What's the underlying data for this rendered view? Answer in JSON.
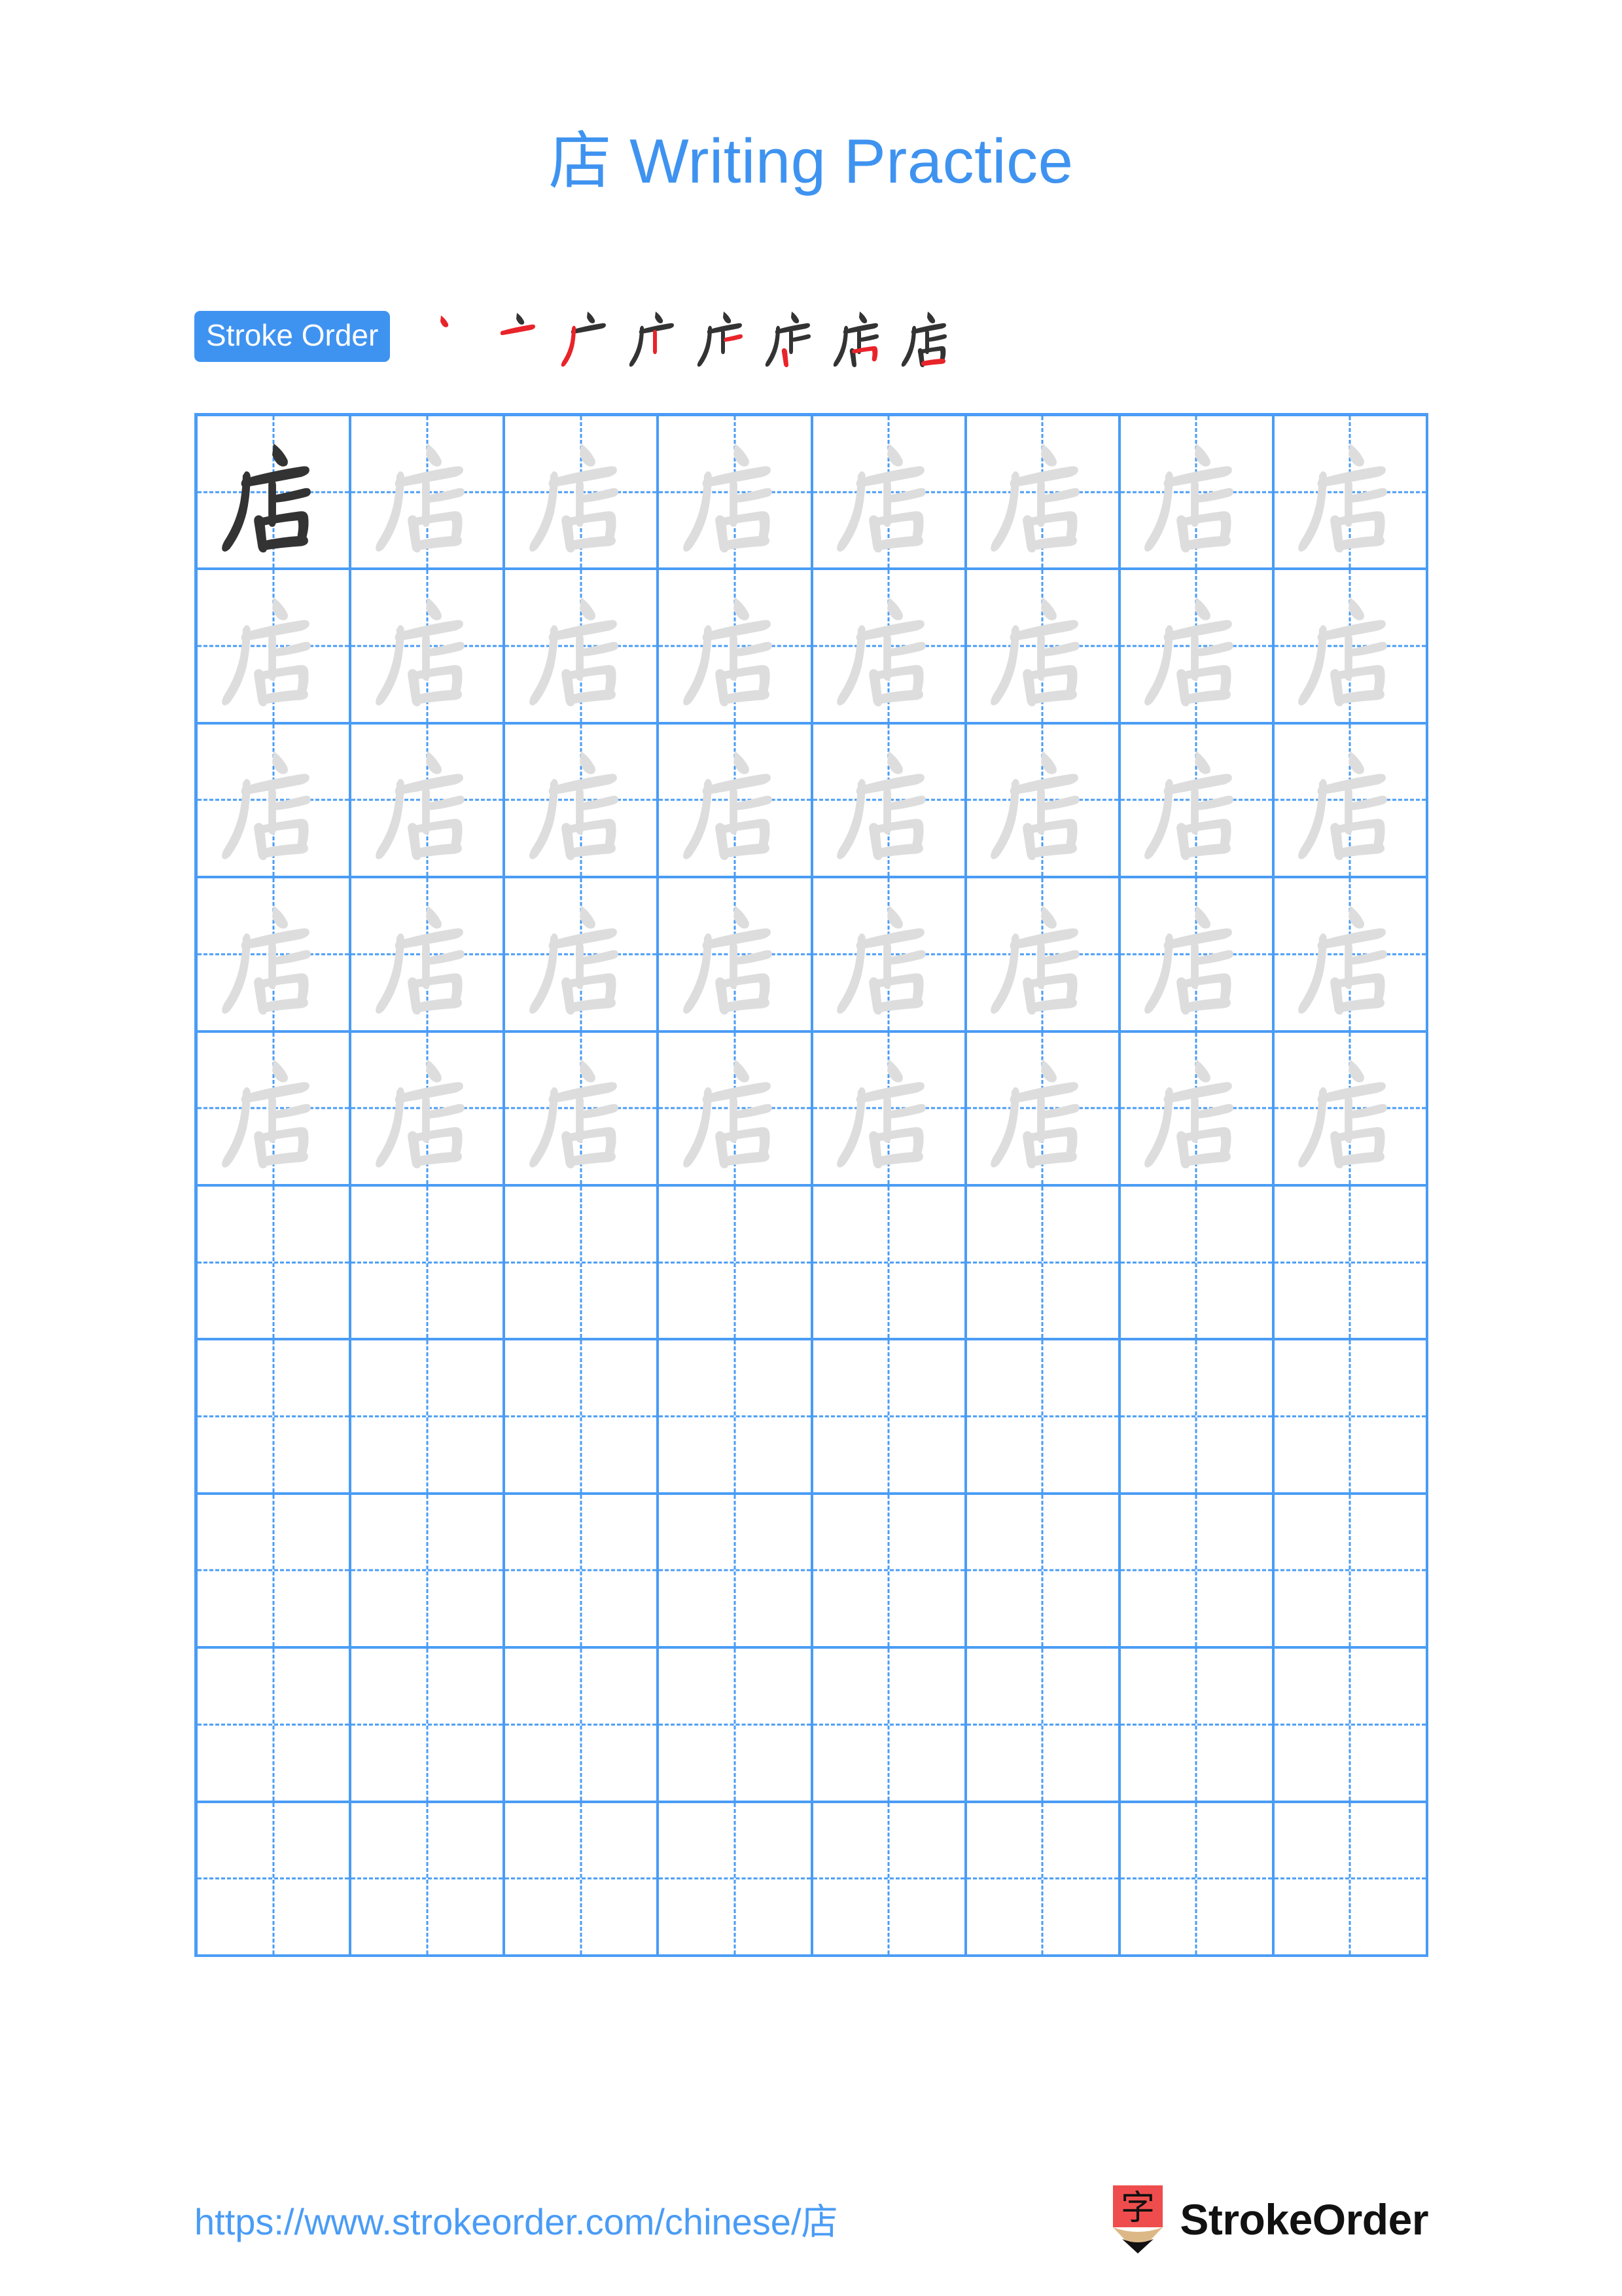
{
  "page": {
    "title": "店 Writing Practice",
    "character": "店",
    "background_color": "#ffffff",
    "accent_color": "#3f93f0",
    "grid_line_color": "#4a9cf5",
    "traced_char_color": "#dddddd",
    "model_char_color": "#333333",
    "new_stroke_color": "#e8242a"
  },
  "stroke_order": {
    "badge_label": "Stroke Order",
    "stroke_count": 8,
    "steps": [
      {
        "index": 1,
        "partial": "丶",
        "new_stroke": "dot"
      },
      {
        "index": 2,
        "partial": "亠",
        "new_stroke": "horizontal"
      },
      {
        "index": 3,
        "partial": "广",
        "new_stroke": "left-falling"
      },
      {
        "index": 4,
        "partial": "广丨",
        "new_stroke": "vertical"
      },
      {
        "index": 5,
        "partial": "广卜",
        "new_stroke": "short-horizontal"
      },
      {
        "index": 6,
        "partial": "广占",
        "new_stroke": "vertical"
      },
      {
        "index": 7,
        "partial": "店",
        "new_stroke": "horizontal-turn"
      },
      {
        "index": 8,
        "partial": "店",
        "new_stroke": "bottom-horizontal"
      }
    ]
  },
  "practice_grid": {
    "columns": 8,
    "rows": 10,
    "total_cells": 80,
    "model_cells": 1,
    "traced_cells": 39,
    "blank_cells": 40,
    "character": "店"
  },
  "footer": {
    "url": "https://www.strokeorder.com/chinese/店",
    "brand_name": "StrokeOrder",
    "logo_character": "字",
    "logo_body_color": "#ef4d4d",
    "logo_wood_color": "#ddb887",
    "logo_tip_color": "#111111"
  }
}
